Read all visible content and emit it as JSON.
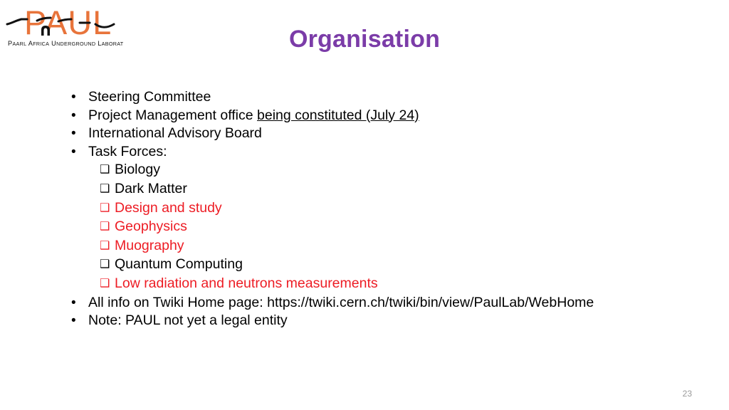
{
  "logo": {
    "wordmark": "PAUL",
    "subtitle": "Paarl Africa Underground Laboratory",
    "orange": "#E8743B",
    "black": "#1a1a1a"
  },
  "title": "Organisation",
  "title_color": "#7B3CA8",
  "accent_red": "#ED1C24",
  "bullets": [
    {
      "level": 1,
      "marker": "•",
      "text": "Steering Committee",
      "color": "black",
      "underline_part": ""
    },
    {
      "level": 1,
      "marker": "•",
      "text": "Project Management office ",
      "underline_part": "being constituted (July 24)",
      "color": "black"
    },
    {
      "level": 1,
      "marker": "•",
      "text": "International Advisory Board",
      "color": "black",
      "underline_part": ""
    },
    {
      "level": 1,
      "marker": "•",
      "text": "Task Forces:",
      "color": "black",
      "underline_part": ""
    },
    {
      "level": 2,
      "marker": "❑",
      "text": "Biology",
      "color": "black",
      "underline_part": ""
    },
    {
      "level": 2,
      "marker": "❑",
      "text": "Dark Matter",
      "color": "black",
      "underline_part": ""
    },
    {
      "level": 2,
      "marker": "❑",
      "text": "Design and study",
      "color": "red",
      "underline_part": ""
    },
    {
      "level": 2,
      "marker": "❑",
      "text": "Geophysics",
      "color": "red",
      "underline_part": ""
    },
    {
      "level": 2,
      "marker": "❑",
      "text": "Muography",
      "color": "red",
      "underline_part": ""
    },
    {
      "level": 2,
      "marker": "❑",
      "text": "Quantum Computing",
      "color": "black",
      "underline_part": ""
    },
    {
      "level": 2,
      "marker": "❑",
      "text": "Low radiation and neutrons measurements",
      "color": "red",
      "underline_part": ""
    },
    {
      "level": 1,
      "marker": "•",
      "text": "All info on Twiki Home page: https://twiki.cern.ch/twiki/bin/view/PaulLab/WebHome",
      "color": "black",
      "underline_part": ""
    },
    {
      "level": 1,
      "marker": "•",
      "text": "Note: PAUL not yet a legal entity",
      "color": "black",
      "underline_part": ""
    }
  ],
  "page_number": "23"
}
